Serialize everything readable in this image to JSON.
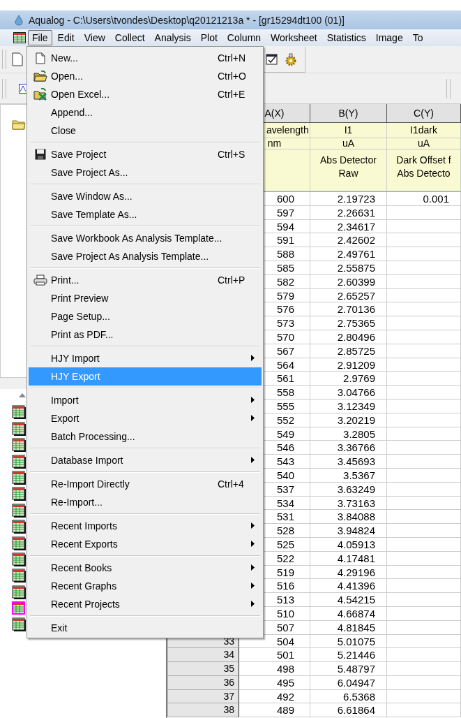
{
  "window": {
    "title": "Aqualog - C:\\Users\\tvondes\\Desktop\\q20121213a * - [gr15294dt100 (01)]"
  },
  "menubar": [
    {
      "label": "File",
      "selected": true
    },
    {
      "label": "Edit",
      "selected": false
    },
    {
      "label": "View",
      "selected": false
    },
    {
      "label": "Collect",
      "selected": false
    },
    {
      "label": "Analysis",
      "selected": false
    },
    {
      "label": "Plot",
      "selected": false
    },
    {
      "label": "Column",
      "selected": false
    },
    {
      "label": "Worksheet",
      "selected": false
    },
    {
      "label": "Statistics",
      "selected": false
    },
    {
      "label": "Image",
      "selected": false
    },
    {
      "label": "To",
      "selected": false
    }
  ],
  "file_menu": [
    [
      {
        "label": "New...",
        "shortcut": "Ctrl+N",
        "kind": "document",
        "submenu": false,
        "selected": false
      },
      {
        "label": "Open...",
        "shortcut": "Ctrl+O",
        "kind": "folder",
        "submenu": false,
        "selected": false
      },
      {
        "label": "Open Excel...",
        "shortcut": "Ctrl+E",
        "kind": "spreadsheet",
        "submenu": false,
        "selected": false
      },
      {
        "label": "Append...",
        "submenu": false,
        "selected": false
      },
      {
        "label": "Close",
        "submenu": false,
        "selected": false
      }
    ],
    [
      {
        "label": "Save Project",
        "shortcut": "Ctrl+S",
        "kind": "floppy",
        "submenu": false,
        "selected": false
      },
      {
        "label": "Save Project As...",
        "submenu": false,
        "selected": false
      }
    ],
    [
      {
        "label": "Save Window As...",
        "submenu": false,
        "selected": false
      },
      {
        "label": "Save Template As...",
        "submenu": false,
        "selected": false
      }
    ],
    [
      {
        "label": "Save Workbook As Analysis Template...",
        "submenu": false,
        "selected": false
      },
      {
        "label": "Save Project As Analysis Template...",
        "submenu": false,
        "selected": false
      }
    ],
    [
      {
        "label": "Print...",
        "shortcut": "Ctrl+P",
        "kind": "printer",
        "submenu": false,
        "selected": false
      },
      {
        "label": "Print Preview",
        "submenu": false,
        "selected": false
      },
      {
        "label": "Page Setup...",
        "submenu": false,
        "selected": false
      },
      {
        "label": "Print as PDF...",
        "submenu": false,
        "selected": false
      }
    ],
    [
      {
        "label": "HJY Import",
        "submenu": true,
        "selected": false
      },
      {
        "label": "HJY Export",
        "submenu": false,
        "selected": true
      }
    ],
    [
      {
        "label": "Import",
        "submenu": true,
        "selected": false
      },
      {
        "label": "Export",
        "submenu": true,
        "selected": false
      },
      {
        "label": "Batch Processing...",
        "submenu": false,
        "selected": false
      }
    ],
    [
      {
        "label": "Database Import",
        "submenu": true,
        "selected": false
      }
    ],
    [
      {
        "label": "Re-Import Directly",
        "shortcut": "Ctrl+4",
        "submenu": false,
        "selected": false
      },
      {
        "label": "Re-Import...",
        "submenu": false,
        "selected": false
      }
    ],
    [
      {
        "label": "Recent Imports",
        "submenu": true,
        "selected": false
      },
      {
        "label": "Recent Exports",
        "submenu": true,
        "selected": false
      }
    ],
    [
      {
        "label": "Recent Books",
        "submenu": true,
        "selected": false
      },
      {
        "label": "Recent Graphs",
        "submenu": true,
        "selected": false
      },
      {
        "label": "Recent Projects",
        "submenu": true,
        "selected": false
      }
    ],
    [
      {
        "label": "Exit",
        "submenu": false,
        "selected": false
      }
    ]
  ],
  "workbooks": [
    {
      "selected": false
    },
    {
      "selected": false
    },
    {
      "selected": false
    },
    {
      "selected": false
    },
    {
      "selected": false
    },
    {
      "selected": false
    },
    {
      "selected": false
    },
    {
      "selected": false
    },
    {
      "selected": false
    },
    {
      "selected": false
    },
    {
      "selected": false
    },
    {
      "selected": false
    },
    {
      "selected": true
    },
    {
      "selected": false
    }
  ],
  "worksheet": {
    "columns": [
      {
        "header": "A(X)",
        "long_name": "avelength",
        "units": "nm"
      },
      {
        "header": "B(Y)",
        "long_name": "I1",
        "units": "uA",
        "comment_lines": [
          "Abs Detector",
          "Raw"
        ]
      },
      {
        "header": "C(Y)",
        "long_name": "I1dark",
        "units": "uA",
        "comment_lines": [
          "Dark Offset f",
          "Abs Detecto"
        ]
      }
    ],
    "rows": [
      {
        "cells": [
          "600",
          "2.19723",
          "0.001"
        ]
      },
      {
        "cells": [
          "597",
          "2.26631"
        ]
      },
      {
        "cells": [
          "594",
          "2.34617"
        ]
      },
      {
        "cells": [
          "591",
          "2.42602"
        ]
      },
      {
        "cells": [
          "588",
          "2.49761"
        ]
      },
      {
        "cells": [
          "585",
          "2.55875"
        ]
      },
      {
        "cells": [
          "582",
          "2.60399"
        ]
      },
      {
        "cells": [
          "579",
          "2.65257"
        ]
      },
      {
        "cells": [
          "576",
          "2.70136"
        ]
      },
      {
        "cells": [
          "573",
          "2.75365"
        ]
      },
      {
        "cells": [
          "570",
          "2.80496"
        ]
      },
      {
        "cells": [
          "567",
          "2.85725"
        ]
      },
      {
        "cells": [
          "564",
          "2.91209"
        ]
      },
      {
        "cells": [
          "561",
          "2.9769"
        ]
      },
      {
        "cells": [
          "558",
          "3.04766"
        ]
      },
      {
        "cells": [
          "555",
          "3.12349"
        ]
      },
      {
        "cells": [
          "552",
          "3.20219"
        ]
      },
      {
        "cells": [
          "549",
          "3.2805"
        ]
      },
      {
        "cells": [
          "546",
          "3.36766"
        ]
      },
      {
        "cells": [
          "543",
          "3.45693"
        ]
      },
      {
        "cells": [
          "540",
          "3.5367"
        ]
      },
      {
        "cells": [
          "537",
          "3.63249"
        ]
      },
      {
        "cells": [
          "534",
          "3.73163"
        ]
      },
      {
        "cells": [
          "531",
          "3.84088"
        ]
      },
      {
        "cells": [
          "528",
          "3.94824"
        ]
      },
      {
        "cells": [
          "525",
          "4.05913"
        ]
      },
      {
        "cells": [
          "522",
          "4.17481"
        ]
      },
      {
        "cells": [
          "519",
          "4.29196"
        ]
      },
      {
        "cells": [
          "516",
          "4.41396"
        ]
      },
      {
        "cells": [
          "513",
          "4.54215"
        ]
      },
      {
        "cells": [
          "510",
          "4.66874"
        ]
      },
      {
        "cells": [
          "507",
          "4.81845"
        ]
      },
      {
        "number": "33",
        "cells": [
          "504",
          "5.01075"
        ]
      },
      {
        "number": "34",
        "cells": [
          "501",
          "5.21446"
        ]
      },
      {
        "number": "35",
        "cells": [
          "498",
          "5.48797"
        ]
      },
      {
        "number": "36",
        "cells": [
          "495",
          "6.04947"
        ]
      },
      {
        "number": "37",
        "cells": [
          "492",
          "6.5368"
        ]
      },
      {
        "number": "38",
        "cells": [
          "489",
          "6.61864"
        ]
      }
    ]
  }
}
